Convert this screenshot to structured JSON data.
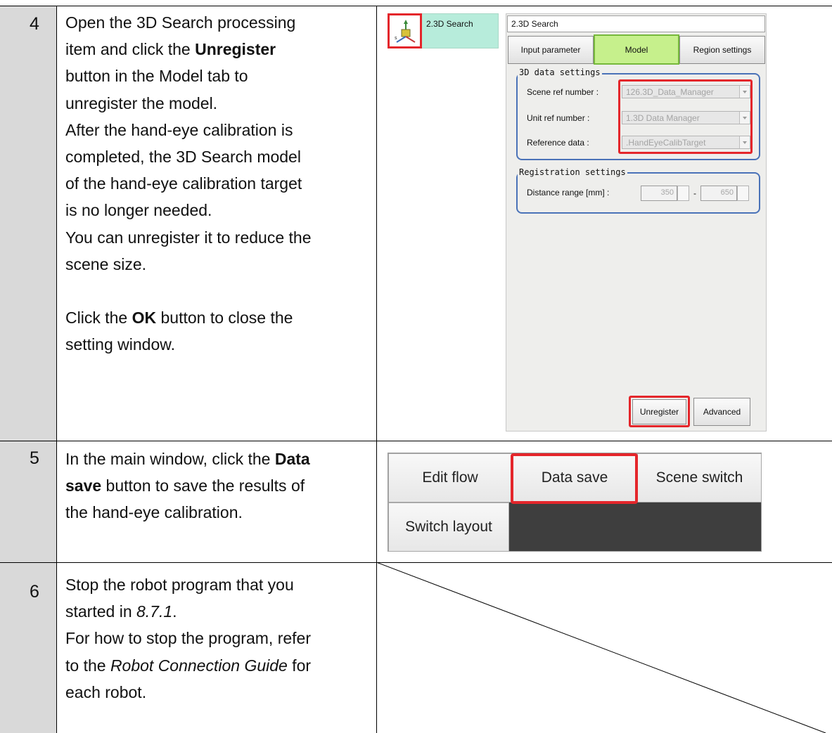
{
  "steps": [
    {
      "number": "4",
      "lines": [
        [
          "Open the 3D Search processing"
        ],
        [
          "item and click the ",
          {
            "b": "Unregister"
          }
        ],
        [
          "button in the Model tab to"
        ],
        [
          "unregister the model."
        ],
        [
          "After the hand-eye calibration is"
        ],
        [
          "completed, the 3D Search model"
        ],
        [
          "of the hand-eye calibration target"
        ],
        [
          "is no longer needed."
        ],
        [
          "You can unregister it to reduce the"
        ],
        [
          "scene size."
        ],
        [],
        [
          "Click the ",
          {
            "b": "OK"
          },
          " button to close the"
        ],
        [
          "setting window."
        ]
      ]
    },
    {
      "number": "5",
      "lines": [
        [
          "In the main window, click the ",
          {
            "b": "Data"
          }
        ],
        [
          {
            "b": "save"
          },
          " button to save the results of"
        ],
        [
          "the hand-eye calibration."
        ]
      ]
    },
    {
      "number": "6",
      "lines": [
        [
          "Stop the robot program that you"
        ],
        [
          "started in ",
          {
            "i": "8.7.1"
          },
          "."
        ],
        [
          "For how to stop the program, refer"
        ],
        [
          "to the ",
          {
            "i": "Robot Connection Guide"
          },
          " for"
        ],
        [
          "each robot."
        ]
      ]
    }
  ],
  "tool_item": {
    "label": "2.3D Search",
    "icon": "3d-search-tool-icon"
  },
  "settings_window": {
    "title": "2.3D Search",
    "tabs": [
      "Input parameter",
      "Model",
      "Region settings"
    ],
    "active_tab": "Model",
    "data_settings": {
      "title": "3D data settings",
      "scene_ref_label": "Scene ref number :",
      "scene_ref_value": "126.3D_Data_Manager",
      "unit_ref_label": "Unit ref number :",
      "unit_ref_value": "1.3D Data Manager",
      "reference_label": "Reference data :",
      "reference_value": ".HandEyeCalibTarget"
    },
    "registration_settings": {
      "title": "Registration settings",
      "distance_label": "Distance range [mm] :",
      "distance_min": "350",
      "distance_sep": "-",
      "distance_max": "650"
    },
    "unregister_label": "Unregister",
    "advanced_label": "Advanced"
  },
  "main_window": {
    "edit_flow_label": "Edit flow",
    "data_save_label": "Data save",
    "scene_switch_label": "Scene switch",
    "switch_layout_label": "Switch layout"
  },
  "colors": {
    "highlight_red": "#e4262b",
    "active_tab_green": "#c6f08c",
    "step_number_column": "#d9d9d9",
    "tool_tile_teal": "#b7ecdb",
    "group_border_blue": "#4a72b8"
  }
}
